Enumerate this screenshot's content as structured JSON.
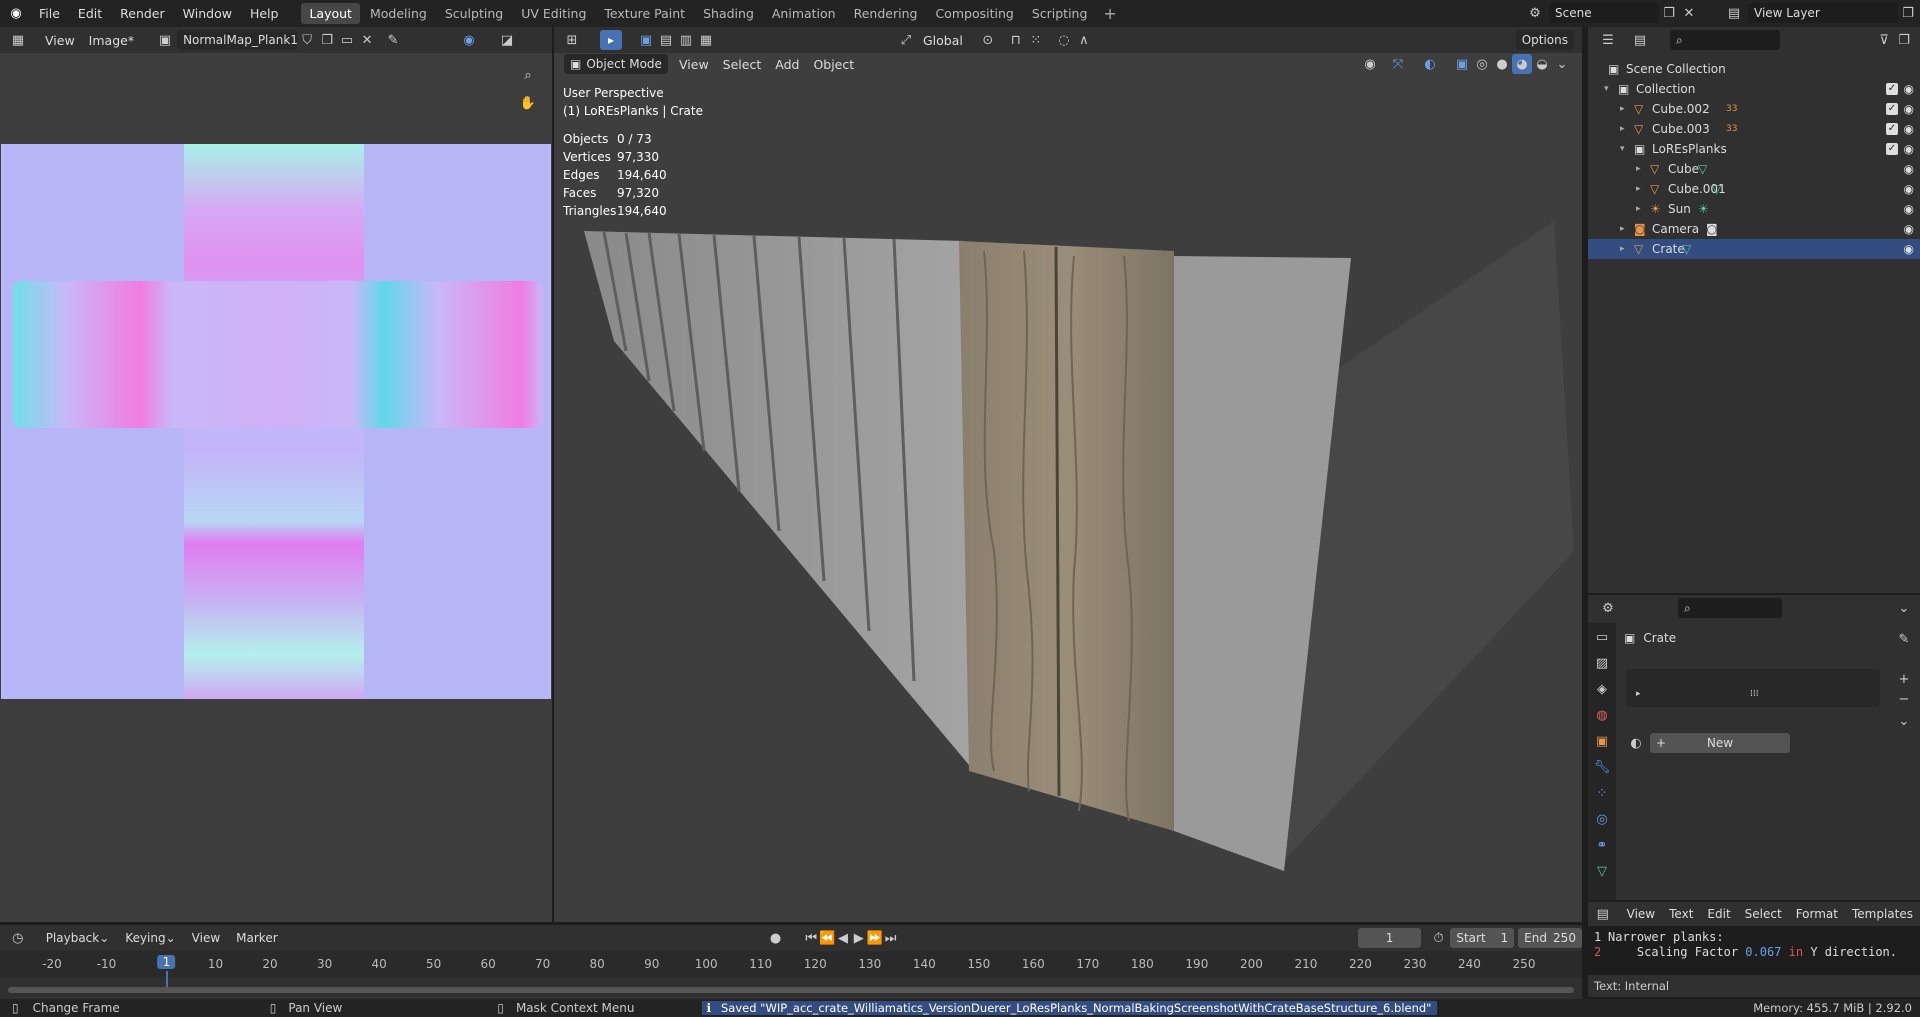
{
  "topbar": {
    "menus": [
      "File",
      "Edit",
      "Render",
      "Window",
      "Help"
    ],
    "workspaces": [
      "Layout",
      "Modeling",
      "Sculpting",
      "UV Editing",
      "Texture Paint",
      "Shading",
      "Animation",
      "Rendering",
      "Compositing",
      "Scripting"
    ],
    "active_workspace": "Layout",
    "scene": "Scene",
    "view_layer": "View Layer"
  },
  "image_editor": {
    "view_menu": "View",
    "image_menu": "Image*",
    "image_name": "NormalMap_Plank1"
  },
  "viewport": {
    "mode": "Object Mode",
    "menus": [
      "View",
      "Select",
      "Add",
      "Object"
    ],
    "orientation": "Global",
    "options": "Options",
    "perspective": "User Perspective",
    "context": "(1) LoREsPlanks | Crate",
    "stats": [
      {
        "k": "Objects",
        "v": "0 / 73"
      },
      {
        "k": "Vertices",
        "v": "97,330"
      },
      {
        "k": "Edges",
        "v": "194,640"
      },
      {
        "k": "Faces",
        "v": "97,320"
      },
      {
        "k": "Triangles",
        "v": "194,640"
      }
    ]
  },
  "outliner": {
    "items": [
      {
        "label": "Scene Collection"
      },
      {
        "label": "Collection"
      },
      {
        "label": "Cube.002",
        "badge": "33"
      },
      {
        "label": "Cube.003",
        "badge": "33"
      },
      {
        "label": "LoREsPlanks"
      },
      {
        "label": "Cube"
      },
      {
        "label": "Cube.001"
      },
      {
        "label": "Sun"
      },
      {
        "label": "Camera"
      },
      {
        "label": "Crate"
      }
    ]
  },
  "properties": {
    "object_name": "Crate",
    "new_button": "New"
  },
  "text_editor": {
    "menus": [
      "View",
      "Text",
      "Edit",
      "Select",
      "Format",
      "Templates"
    ],
    "line1_num": "1",
    "line2_num": "2",
    "line1": "Narrower planks:",
    "line2_a": "    Scaling Factor ",
    "line2_num_val": "0.067",
    "line2_kw": " in ",
    "line2_b": "Y direction.",
    "footer": "Text: Internal"
  },
  "timeline": {
    "menus": [
      "Playback",
      "Keying",
      "View",
      "Marker"
    ],
    "current_frame": "1",
    "start_label": "Start",
    "start": "1",
    "end_label": "End",
    "end": "250",
    "ticks": [
      "-20",
      "-10",
      "1",
      "10",
      "20",
      "30",
      "40",
      "50",
      "60",
      "70",
      "80",
      "90",
      "100",
      "110",
      "120",
      "130",
      "140",
      "150",
      "160",
      "170",
      "180",
      "190",
      "200",
      "210",
      "220",
      "230",
      "240",
      "250"
    ]
  },
  "statusbar": {
    "hint1": "Change Frame",
    "hint2": "Pan View",
    "hint3": "Mask Context Menu",
    "message": "Saved \"WIP_acc_crate_Williamatics_VersionDuerer_LoResPlanks_NormalBakingScreenshotWithCrateBaseStructure_6.blend\"",
    "memory": "Memory: 455.7 MiB | 2.92.0"
  }
}
